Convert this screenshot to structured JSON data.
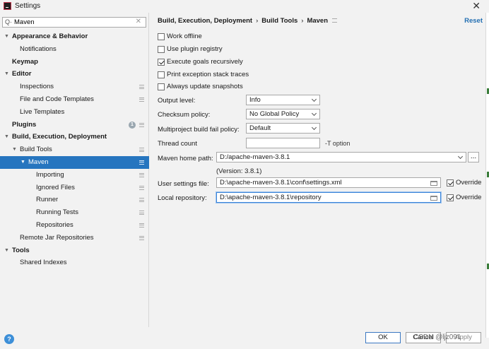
{
  "window": {
    "title": "Settings"
  },
  "search": {
    "value": "Maven"
  },
  "sidebar": {
    "items": [
      {
        "label": "Appearance & Behavior"
      },
      {
        "label": "Notifications"
      },
      {
        "label": "Keymap"
      },
      {
        "label": "Editor"
      },
      {
        "label": "Inspections"
      },
      {
        "label": "File and Code Templates"
      },
      {
        "label": "Live Templates"
      },
      {
        "label": "Plugins",
        "badge": "1"
      },
      {
        "label": "Build, Execution, Deployment"
      },
      {
        "label": "Build Tools"
      },
      {
        "label": "Maven"
      },
      {
        "label": "Importing"
      },
      {
        "label": "Ignored Files"
      },
      {
        "label": "Runner"
      },
      {
        "label": "Running Tests"
      },
      {
        "label": "Repositories"
      },
      {
        "label": "Remote Jar Repositories"
      },
      {
        "label": "Tools"
      },
      {
        "label": "Shared Indexes"
      }
    ]
  },
  "breadcrumb": [
    "Build, Execution, Deployment",
    "Build Tools",
    "Maven"
  ],
  "reset_label": "Reset",
  "checkboxes": [
    {
      "label": "Work offline",
      "checked": false
    },
    {
      "label": "Use plugin registry",
      "checked": false
    },
    {
      "label": "Execute goals recursively",
      "checked": true
    },
    {
      "label": "Print exception stack traces",
      "checked": false
    },
    {
      "label": "Always update snapshots",
      "checked": false
    }
  ],
  "form": {
    "output_level": {
      "label": "Output level:",
      "value": "Info"
    },
    "checksum_policy": {
      "label": "Checksum policy:",
      "value": "No Global Policy"
    },
    "multiproject_fail": {
      "label": "Multiproject build fail policy:",
      "value": "Default"
    },
    "thread_count": {
      "label": "Thread count",
      "value": "",
      "hint": "-T option"
    },
    "maven_home": {
      "label": "Maven home path:",
      "value": "D:/apache-maven-3.8.1",
      "version": "(Version: 3.8.1)",
      "browse": "..."
    },
    "user_settings": {
      "label": "User settings file:",
      "value": "D:\\apache-maven-3.8.1\\conf\\settings.xml",
      "override": "Override",
      "override_checked": true
    },
    "local_repo": {
      "label": "Local repository:",
      "value": "D:\\apache-maven-3.8.1\\repository",
      "override": "Override",
      "override_checked": true
    }
  },
  "footer": {
    "ok": "OK",
    "cancel": "Cancel",
    "apply": "Apply",
    "help": "?"
  },
  "watermark": "CSDN @ljz091",
  "colors": {
    "selection": "#2675bf",
    "link": "#2470b3",
    "focus": "#3b84d8"
  },
  "icons": [
    "app-logo-icon",
    "close-icon",
    "search-icon",
    "clear-icon",
    "expand-arrow-icon",
    "config-icon",
    "folder-icon",
    "help-icon"
  ]
}
